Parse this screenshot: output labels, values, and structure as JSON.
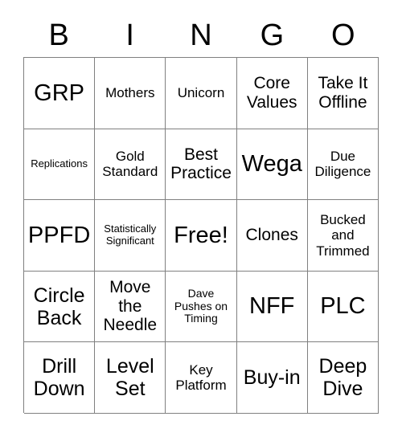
{
  "card": {
    "header_letters": [
      "B",
      "I",
      "N",
      "G",
      "O"
    ],
    "rows": [
      [
        {
          "text": "GRP",
          "size": "fs-xl"
        },
        {
          "text": "Mothers",
          "size": "fs-sm"
        },
        {
          "text": "Unicorn",
          "size": "fs-sm"
        },
        {
          "text": "Core Values",
          "size": "fs-md"
        },
        {
          "text": "Take It Offline",
          "size": "fs-md"
        }
      ],
      [
        {
          "text": "Replications",
          "size": "fs-xxs"
        },
        {
          "text": "Gold Standard",
          "size": "fs-sm"
        },
        {
          "text": "Best Practice",
          "size": "fs-md"
        },
        {
          "text": "Wega",
          "size": "fs-xl"
        },
        {
          "text": "Due Diligence",
          "size": "fs-sm"
        }
      ],
      [
        {
          "text": "PPFD",
          "size": "fs-xl"
        },
        {
          "text": "Statistically Significant",
          "size": "fs-xxs"
        },
        {
          "text": "Free!",
          "size": "fs-xl"
        },
        {
          "text": "Clones",
          "size": "fs-md"
        },
        {
          "text": "Bucked and Trimmed",
          "size": "fs-sm"
        }
      ],
      [
        {
          "text": "Circle Back",
          "size": "fs-lg"
        },
        {
          "text": "Move the Needle",
          "size": "fs-md"
        },
        {
          "text": "Dave Pushes on Timing",
          "size": "fs-xs"
        },
        {
          "text": "NFF",
          "size": "fs-xl"
        },
        {
          "text": "PLC",
          "size": "fs-xl"
        }
      ],
      [
        {
          "text": "Drill Down",
          "size": "fs-lg"
        },
        {
          "text": "Level Set",
          "size": "fs-lg"
        },
        {
          "text": "Key Platform",
          "size": "fs-sm"
        },
        {
          "text": "Buy-in",
          "size": "fs-lg"
        },
        {
          "text": "Deep Dive",
          "size": "fs-lg"
        }
      ]
    ],
    "colors": {
      "border": "#808080",
      "background": "#ffffff",
      "text": "#000000"
    }
  }
}
